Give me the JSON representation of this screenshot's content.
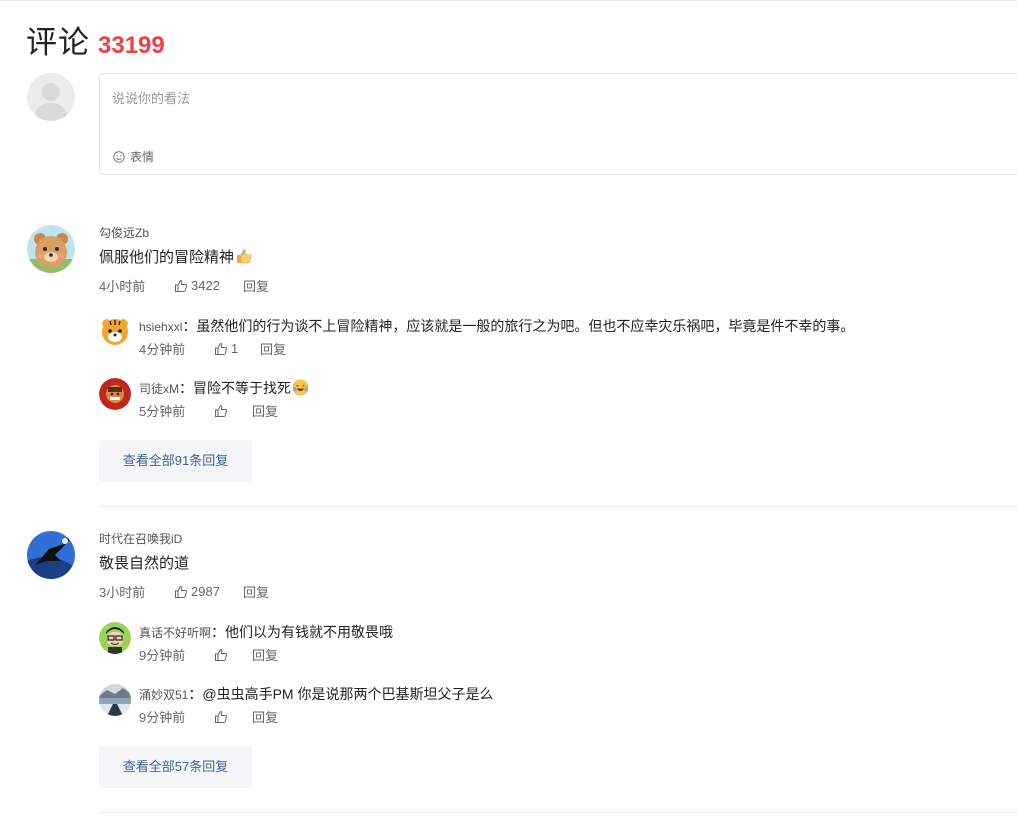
{
  "header": {
    "title": "评论",
    "count": "33199"
  },
  "composer": {
    "placeholder": "说说你的看法",
    "emoji_label": "表情"
  },
  "comments": [
    {
      "user": "勾俊远Zb",
      "text": "佩服他们的冒险精神",
      "time": "4小时前",
      "likes": "3422",
      "reply_label": "回复",
      "replies": [
        {
          "user": "hsiehxxl",
          "text": "虽然他们的行为谈不上冒险精神，应该就是一般的旅行之为吧。但也不应幸灾乐祸吧，毕竟是件不幸的事。",
          "time": "4分钟前",
          "likes": "1",
          "reply_label": "回复"
        },
        {
          "user": "司徒xM",
          "text": "冒险不等于找死",
          "time": "5分钟前",
          "likes": "",
          "reply_label": "回复"
        }
      ],
      "view_all": "查看全部91条回复"
    },
    {
      "user": "时代在召唤我iD",
      "text": "敬畏自然的道",
      "time": "3小时前",
      "likes": "2987",
      "reply_label": "回复",
      "replies": [
        {
          "user": "真话不好听啊",
          "text": "他们以为有钱就不用敬畏哦",
          "time": "9分钟前",
          "likes": "",
          "reply_label": "回复"
        },
        {
          "user": "涌妙双51",
          "text": "@虫虫高手PM 你是说那两个巴基斯坦父子是么",
          "time": "9分钟前",
          "likes": "",
          "reply_label": "回复"
        }
      ],
      "view_all": "查看全部57条回复"
    }
  ],
  "colors": {
    "count": "#f04142",
    "link": "#406599",
    "button_bg": "#f4f5f6"
  },
  "icons": [
    "smile-icon",
    "thumbs-up-icon",
    "thumbs-up-emoji",
    "laughing-tears-emoji"
  ]
}
